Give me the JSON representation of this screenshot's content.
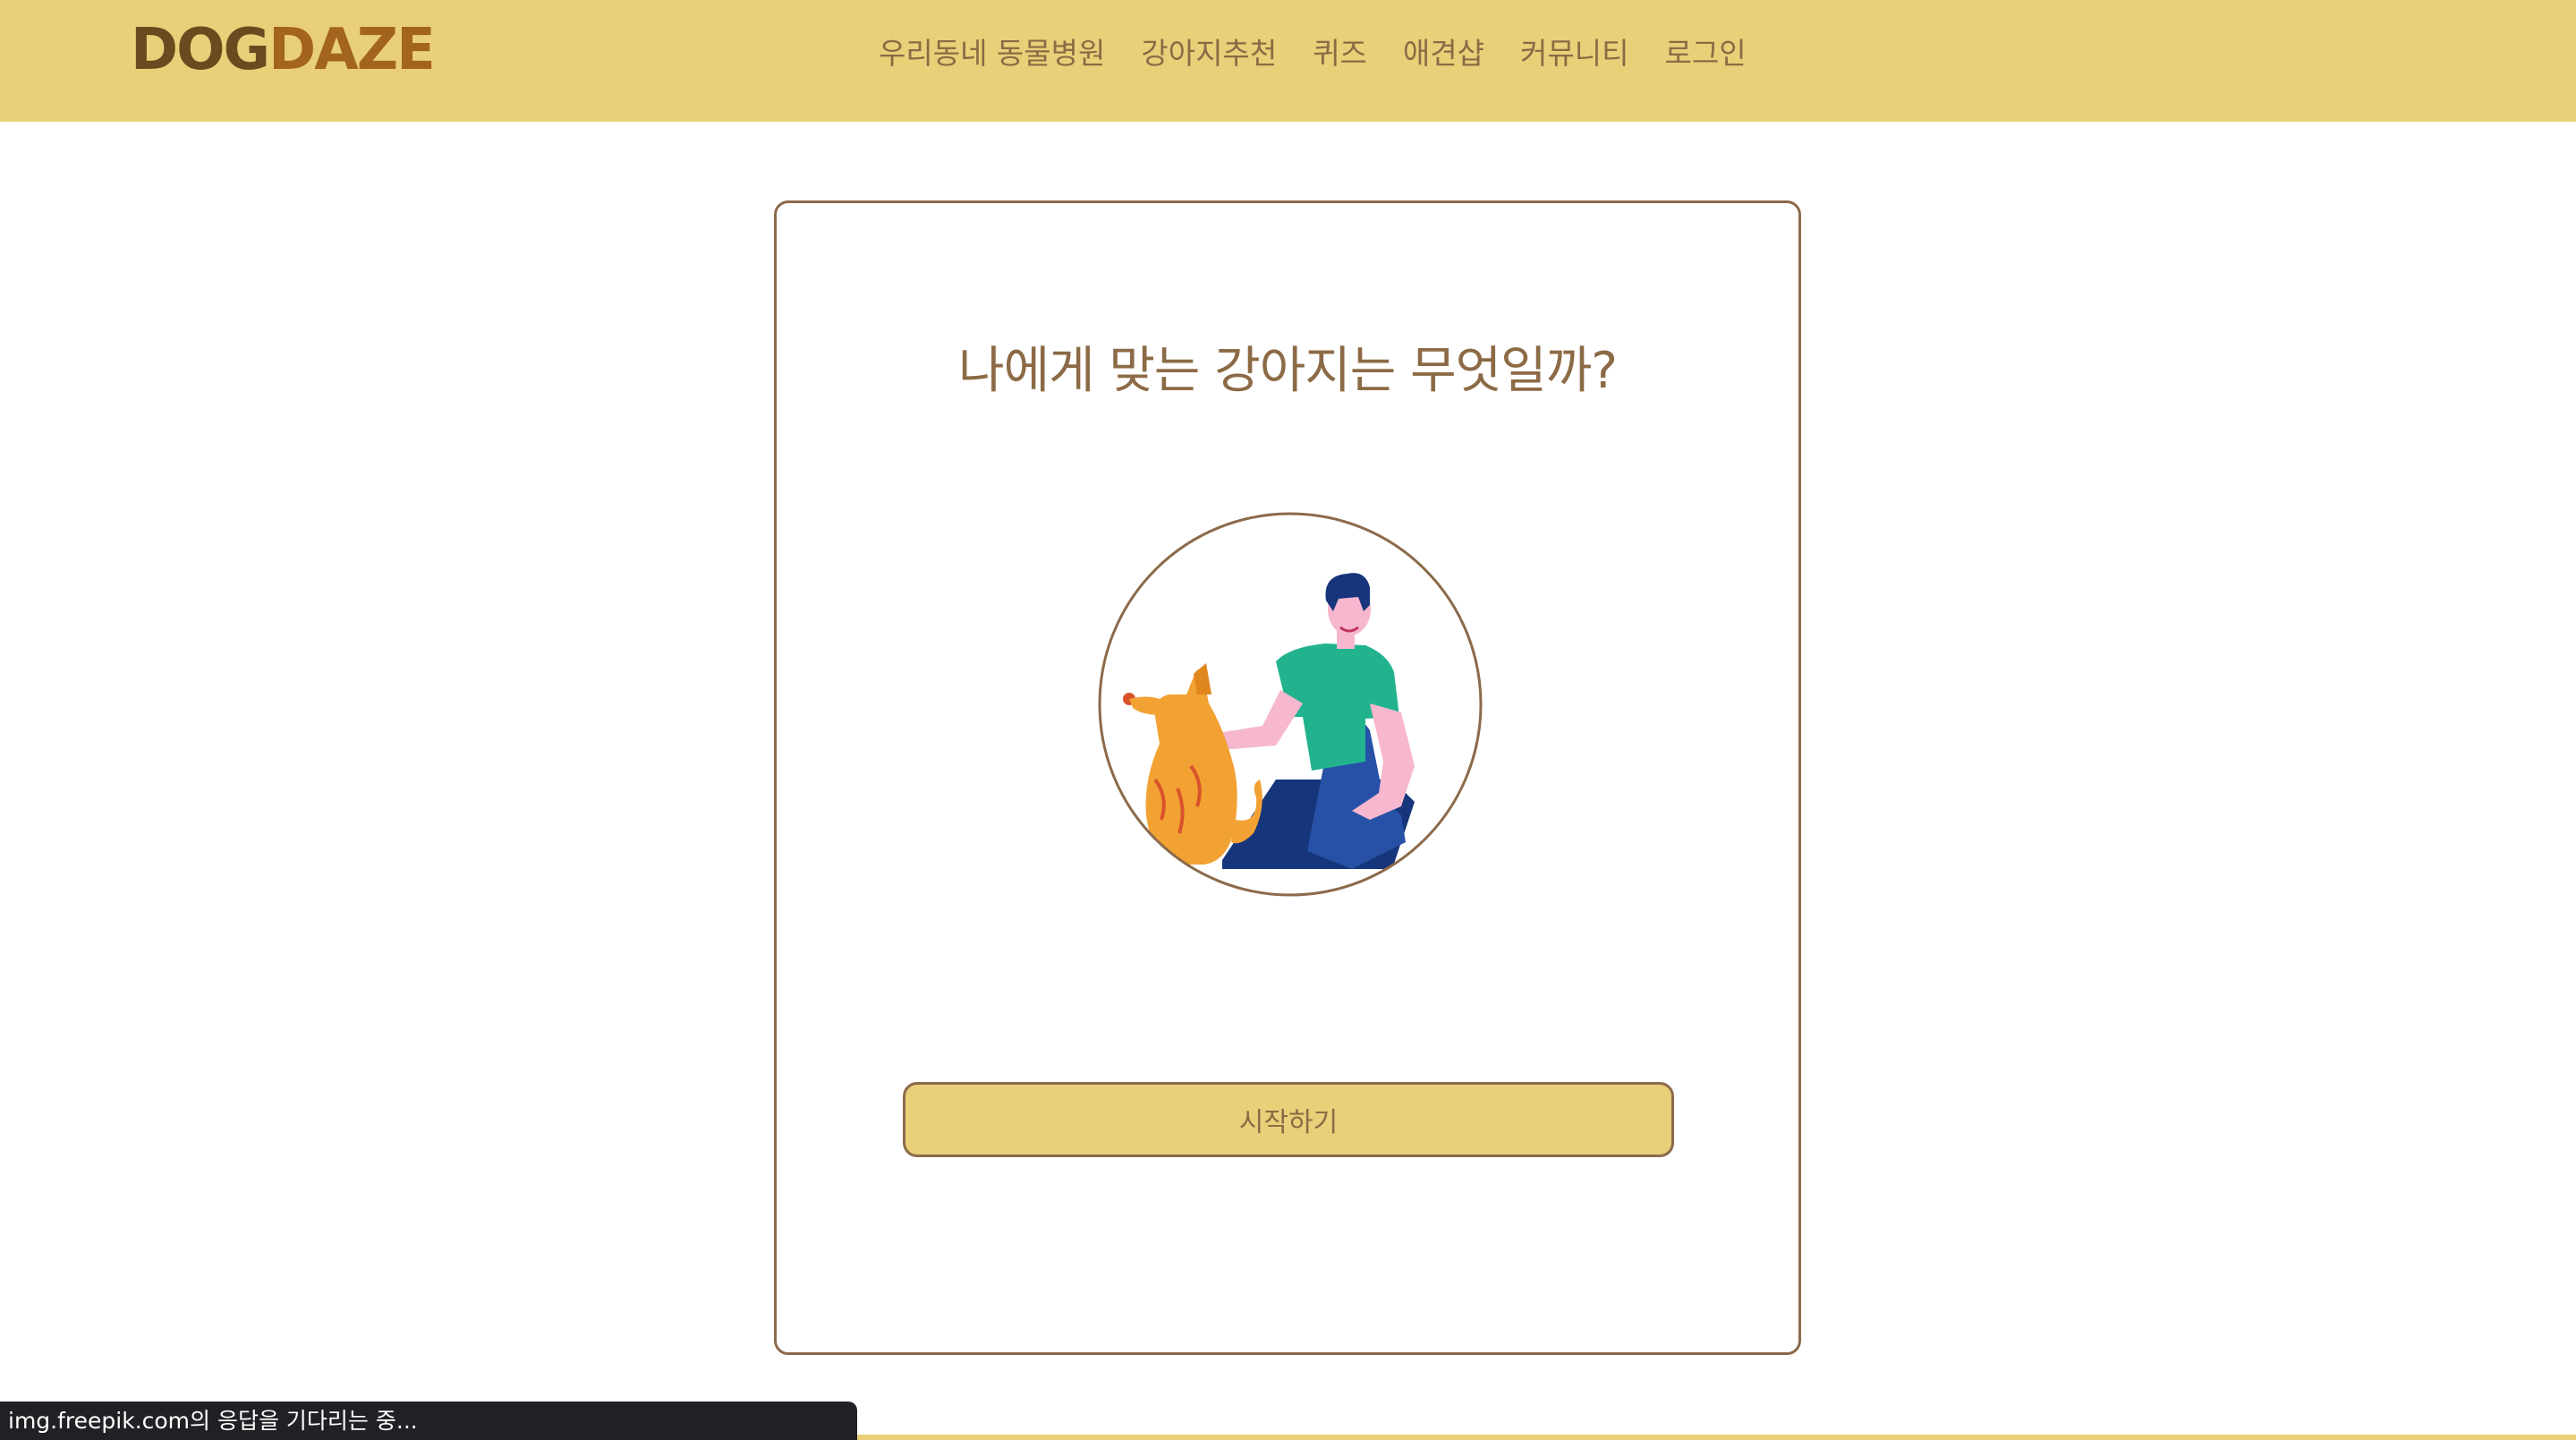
{
  "header": {
    "logo_part1": "DOG",
    "logo_part2": "DAZE",
    "nav": [
      "우리동네 동물병원",
      "강아지추천",
      "퀴즈",
      "애견샵",
      "커뮤니티",
      "로그인"
    ]
  },
  "main": {
    "title": "나에게 맞는 강아지는 무엇일까?",
    "illustration_icon": "person-with-dog-illustration",
    "start_button": "시작하기"
  },
  "status_bar": {
    "text": "img.freepik.com의 응답을 기다리는 중..."
  },
  "colors": {
    "header_bg": "#e9cf78",
    "brand_brown": "#8c6a45",
    "logo_dark": "#6b4a20",
    "logo_orange": "#a3641e",
    "border": "#8c6a4a"
  }
}
